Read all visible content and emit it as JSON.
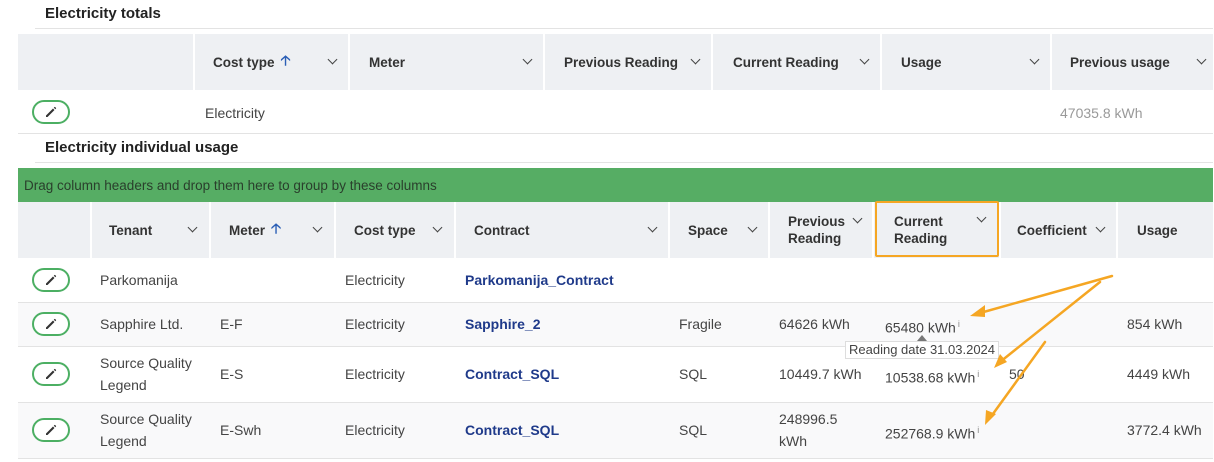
{
  "totals": {
    "title": "Electricity totals",
    "headers": [
      "Cost type",
      "Meter",
      "Previous Reading",
      "Current Reading",
      "Usage",
      "Previous usage"
    ],
    "row": {
      "cost_type": "Electricity",
      "previous_usage": "47035.8 kWh"
    }
  },
  "individual": {
    "title": "Electricity individual usage",
    "group_hint": "Drag column headers and drop them here to group by these columns",
    "headers": {
      "tenant": "Tenant",
      "meter": "Meter",
      "cost_type": "Cost type",
      "contract": "Contract",
      "space": "Space",
      "previous_reading_1": "Previous",
      "previous_reading_2": "Reading",
      "current_reading_1": "Current",
      "current_reading_2": "Reading",
      "coefficient": "Coefficient",
      "usage": "Usage"
    },
    "rows": [
      {
        "tenant_1": "Parkomanija",
        "tenant_2": "",
        "meter": "",
        "cost_type": "Electricity",
        "contract": "Parkomanija_Contract",
        "space": "",
        "previous_1": "",
        "previous_2": "",
        "current": "",
        "coefficient": "",
        "usage": ""
      },
      {
        "tenant_1": "Sapphire Ltd.",
        "tenant_2": "",
        "meter": "E-F",
        "cost_type": "Electricity",
        "contract": "Sapphire_2",
        "space": "Fragile",
        "previous_1": "64626 kWh",
        "previous_2": "",
        "current": "65480 kWh",
        "coefficient": "",
        "usage": "854 kWh"
      },
      {
        "tenant_1": "Source Quality",
        "tenant_2": "Legend",
        "meter": "E-S",
        "cost_type": "Electricity",
        "contract": "Contract_SQL",
        "space": "SQL",
        "previous_1": "10449.7 kWh",
        "previous_2": "",
        "current": "10538.68 kWh",
        "coefficient": "50",
        "usage": "4449 kWh"
      },
      {
        "tenant_1": "Source Quality",
        "tenant_2": "Legend",
        "meter": "E-Swh",
        "cost_type": "Electricity",
        "contract": "Contract_SQL",
        "space": "SQL",
        "previous_1": "248996.5",
        "previous_2": "kWh",
        "current": "252768.9 kWh",
        "coefficient": "",
        "usage": "3772.4 kWh"
      }
    ],
    "info_marker": "i",
    "tooltip": "Reading date 31.03.2024"
  },
  "colors": {
    "accent_green": "#56ad64",
    "link_blue": "#1f3a8a",
    "highlight_orange": "#f5a623"
  },
  "icons": {
    "edit": "pencil-icon",
    "sort": "arrow-up-icon",
    "menu": "chevron-down-icon"
  }
}
